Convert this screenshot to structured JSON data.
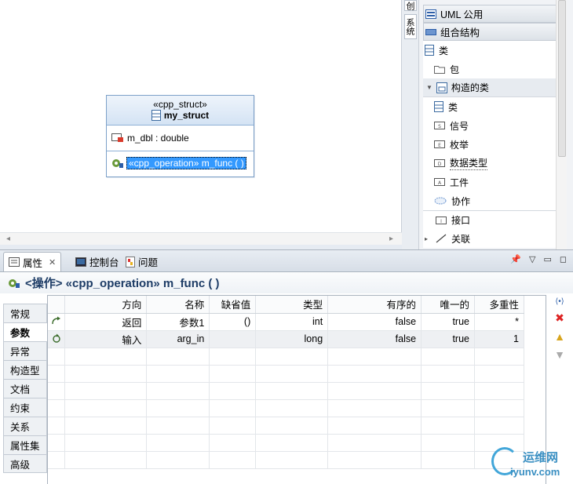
{
  "diagram": {
    "struct": {
      "stereotype": "«cpp_struct»",
      "name": "my_struct",
      "attribute": "m_dbl : double",
      "operation": "«cpp_operation» m_func ( )"
    }
  },
  "palette": {
    "vertical_tabs": [
      "创",
      "系统"
    ],
    "drawers": [
      {
        "label": "UML 公用",
        "icon": "uml-drawer-icon"
      },
      {
        "label": "组合结构",
        "icon": "composite-drawer-icon"
      }
    ],
    "items_top": [
      {
        "label": "类",
        "icon": "class-icon"
      },
      {
        "label": "包",
        "icon": "package-icon"
      }
    ],
    "stack_label": "构造的类",
    "items_stack": [
      {
        "label": "类",
        "icon": "class-icon"
      },
      {
        "label": "信号",
        "icon": "signal-icon"
      },
      {
        "label": "枚举",
        "icon": "enum-icon"
      },
      {
        "label": "数据类型",
        "icon": "datatype-icon"
      },
      {
        "label": "工件",
        "icon": "artifact-icon"
      },
      {
        "label": "协作",
        "icon": "collaboration-icon"
      }
    ],
    "items_bottom": [
      {
        "label": "接口",
        "icon": "interface-icon"
      },
      {
        "label": "关联",
        "icon": "association-icon"
      }
    ]
  },
  "views": {
    "tabs": [
      {
        "label": "属性",
        "icon": "properties-icon",
        "active": true
      },
      {
        "label": "控制台",
        "icon": "console-icon",
        "active": false
      },
      {
        "label": "问题",
        "icon": "problems-icon",
        "active": false
      }
    ]
  },
  "properties": {
    "title": "<操作> «cpp_operation» m_func ( )",
    "side_tabs": [
      "常规",
      "参数",
      "异常",
      "构造型",
      "文档",
      "约束",
      "关系",
      "属性集",
      "高级"
    ],
    "active_side_tab": "参数",
    "columns": [
      "方向",
      "名称",
      "缺省值",
      "类型",
      "有序的",
      "唯一的",
      "多重性"
    ],
    "rows": [
      {
        "direction": "返回",
        "name": "参数1",
        "default": "()",
        "type": "int",
        "ordered": "false",
        "unique": "true",
        "multiplicity": "*"
      },
      {
        "direction": "输入",
        "name": "arg_in",
        "default": "",
        "type": "long",
        "ordered": "false",
        "unique": "true",
        "multiplicity": "1"
      }
    ],
    "buttons": [
      "insert-param-icon",
      "delete-icon",
      "move-up-icon",
      "move-down-icon"
    ]
  },
  "watermark": {
    "cn": "运维网",
    "en": "iyunv.com"
  },
  "colors": {
    "accent": "#3399ff",
    "struct_border": "#7da1c9",
    "title_text": "#1d3c66",
    "watermark": "#3a8fc2"
  }
}
